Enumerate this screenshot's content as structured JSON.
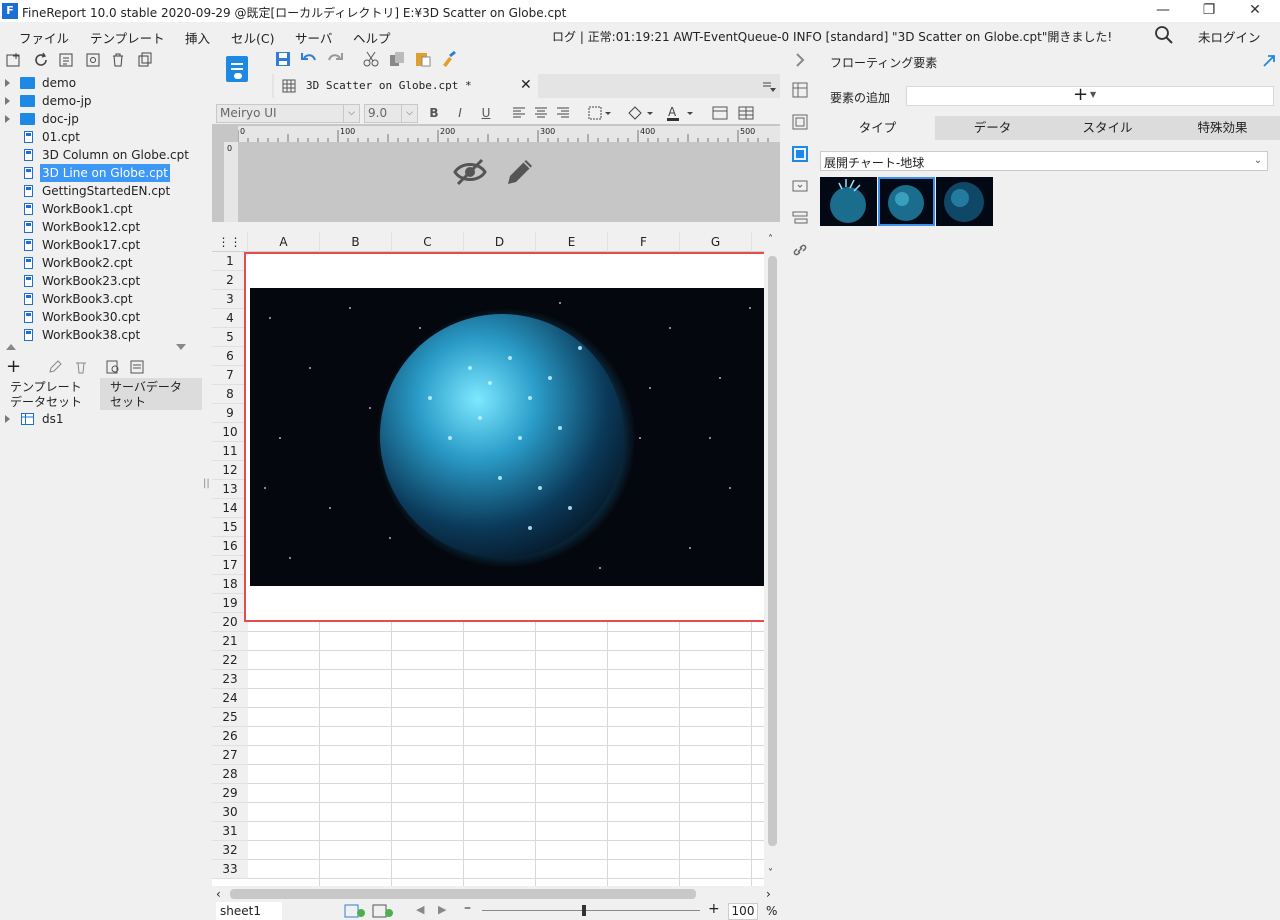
{
  "window": {
    "title": "FineReport 10.0 stable 2020-09-29 @既定[ローカルディレクトリ]   E:¥3D Scatter on Globe.cpt",
    "logo_letter": "F"
  },
  "menu": {
    "items": [
      "ファイル",
      "テンプレート",
      "挿入",
      "セル(C)",
      "サーバ",
      "ヘルプ"
    ],
    "log": "ログ | 正常:01:19:21 AWT-EventQueue-0 INFO [standard] \"3D Scatter on Globe.cpt\"開きました!",
    "login": "未ログイン"
  },
  "tree": {
    "items": [
      {
        "label": "demo",
        "type": "folder"
      },
      {
        "label": "demo-jp",
        "type": "folder"
      },
      {
        "label": "doc-jp",
        "type": "folder"
      },
      {
        "label": "01.cpt",
        "type": "file"
      },
      {
        "label": "3D Column on Globe.cpt",
        "type": "file"
      },
      {
        "label": "3D Line on Globe.cpt",
        "type": "file",
        "selected": true
      },
      {
        "label": "GettingStartedEN.cpt",
        "type": "file"
      },
      {
        "label": "WorkBook1.cpt",
        "type": "file"
      },
      {
        "label": "WorkBook12.cpt",
        "type": "file"
      },
      {
        "label": "WorkBook17.cpt",
        "type": "file"
      },
      {
        "label": "WorkBook2.cpt",
        "type": "file"
      },
      {
        "label": "WorkBook23.cpt",
        "type": "file"
      },
      {
        "label": "WorkBook3.cpt",
        "type": "file"
      },
      {
        "label": "WorkBook30.cpt",
        "type": "file"
      },
      {
        "label": "WorkBook38.cpt",
        "type": "file"
      }
    ]
  },
  "dataset": {
    "tab_template": "テンプレート\nデータセット",
    "tab_server": "サーバデータ\nセット",
    "tab_template_l1": "テンプレート",
    "tab_template_l2": "データセット",
    "tab_server_l1": "サーバデータ",
    "tab_server_l2": "セット",
    "items": [
      "ds1"
    ]
  },
  "editor": {
    "doc_tab": "3D Scatter on Globe.cpt *",
    "font": "Meiryo UI",
    "font_size": "9.0",
    "ruler_ticks": [
      "0",
      "100",
      "200",
      "300",
      "400",
      "500"
    ],
    "columns": [
      "A",
      "B",
      "C",
      "D",
      "E",
      "F",
      "G"
    ],
    "rows": [
      "1",
      "2",
      "3",
      "4",
      "5",
      "6",
      "7",
      "8",
      "9",
      "10",
      "11",
      "12",
      "13",
      "14",
      "15",
      "16",
      "17",
      "18",
      "19",
      "20",
      "21",
      "22",
      "23",
      "24",
      "25",
      "26",
      "27",
      "28",
      "29",
      "30",
      "31",
      "32",
      "33"
    ],
    "sheet": "sheet1",
    "zoom": "100",
    "zoom_unit": "%"
  },
  "right_panel": {
    "title": "フローティング要素",
    "add_label": "要素の追加",
    "tabs": [
      "タイプ",
      "データ",
      "スタイル",
      "特殊効果"
    ],
    "active_tab": 0,
    "chart_type": "展開チャート-地球",
    "selected_thumb": 1
  },
  "colors": {
    "accent": "#3d97f5",
    "selection_border": "#e84b4b",
    "folder": "#1e88e5"
  }
}
